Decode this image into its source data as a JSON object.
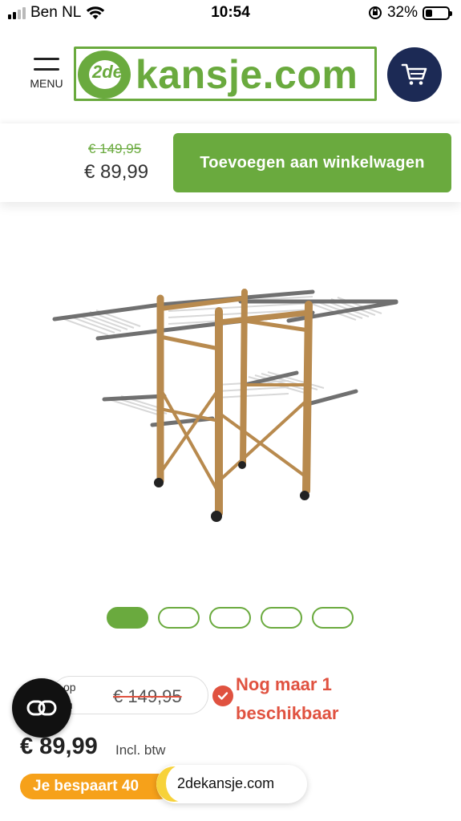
{
  "status_bar": {
    "carrier": "Ben NL",
    "time": "10:54",
    "battery_percent": "32%",
    "battery_level": 0.32
  },
  "header": {
    "menu_label": "MENU",
    "logo_mark": "2de",
    "logo_text": "kansje.com",
    "cart_icon": "shopping-cart-icon"
  },
  "buy_bar": {
    "old_price": "€ 149,95",
    "price": "€ 89,99",
    "add_to_cart_label": "Toevoegen aan winkelwagen"
  },
  "gallery": {
    "image_alt": "Houten droogrek met uitklapbare vleugels",
    "dots": [
      {
        "active": true
      },
      {
        "active": false
      },
      {
        "active": false
      },
      {
        "active": false
      },
      {
        "active": false
      }
    ],
    "active_index": 0
  },
  "pricing": {
    "compare_label_1": "op",
    "compare_label_2": "m",
    "compare_old_price": "€ 149,95",
    "stock_line_1": "Nog maar 1",
    "stock_line_2": "beschikbaar",
    "price": "€ 89,99",
    "tax_note": "Incl. btw",
    "savings": "Je bespaart 40",
    "store_badge": "2dekansje.com"
  },
  "colors": {
    "brand_green": "#6aaa3e",
    "cart_navy": "#1c2a55",
    "alert_red": "#e05240",
    "savings_orange": "#f6a11a"
  }
}
